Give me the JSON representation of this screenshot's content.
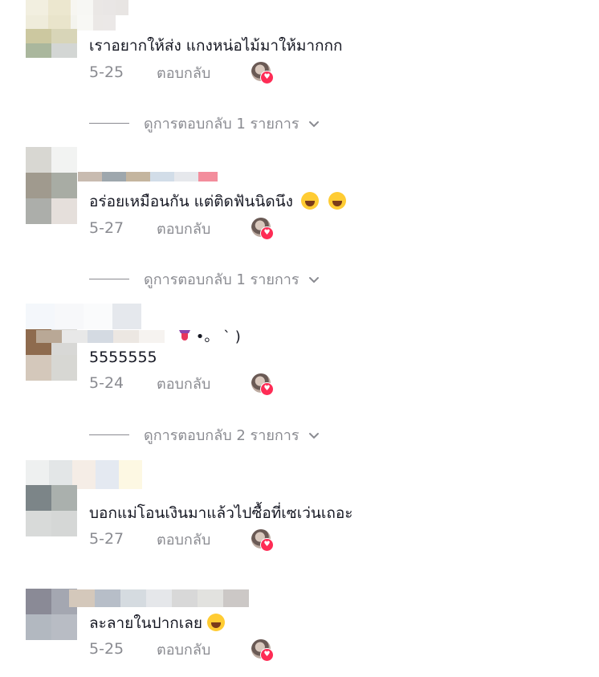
{
  "comments": [
    {
      "text": "เราอยากให้ส่ง แกงหน่อไม้มาให้มากกก",
      "date": "5-25",
      "reply_label": "ตอบกลับ",
      "view_replies": "ดูการตอบกลับ 1 รายการ"
    },
    {
      "text": "อร่อยเหมือนกัน แต่ติดฟันนิดนึง",
      "emojis": [
        "grinning-squinting-face",
        "face-with-tears-of-joy"
      ],
      "date": "5-27",
      "reply_label": "ตอบกลับ",
      "view_replies": "ดูการตอบกลับ 1 รายการ"
    },
    {
      "name_suffix": "•。 ` )",
      "text": "5555555",
      "date": "5-24",
      "reply_label": "ตอบกลับ",
      "view_replies": "ดูการตอบกลับ 2 รายการ"
    },
    {
      "text": "บอกแม่โอนเงินมาแล้วไปซื้อที่เซเว่นเถอะ",
      "date": "5-27",
      "reply_label": "ตอบกลับ"
    },
    {
      "text": "ละลายในปากเลย",
      "emojis": [
        "grinning-face-with-teeth"
      ],
      "date": "5-25",
      "reply_label": "ตอบกลับ"
    }
  ],
  "icons": {
    "liked_badge": "heart-icon",
    "expand": "chevron-down-icon"
  },
  "colors": {
    "text": "#161823",
    "secondary": "#8a8b91",
    "like_badge": "#fe2c55"
  }
}
